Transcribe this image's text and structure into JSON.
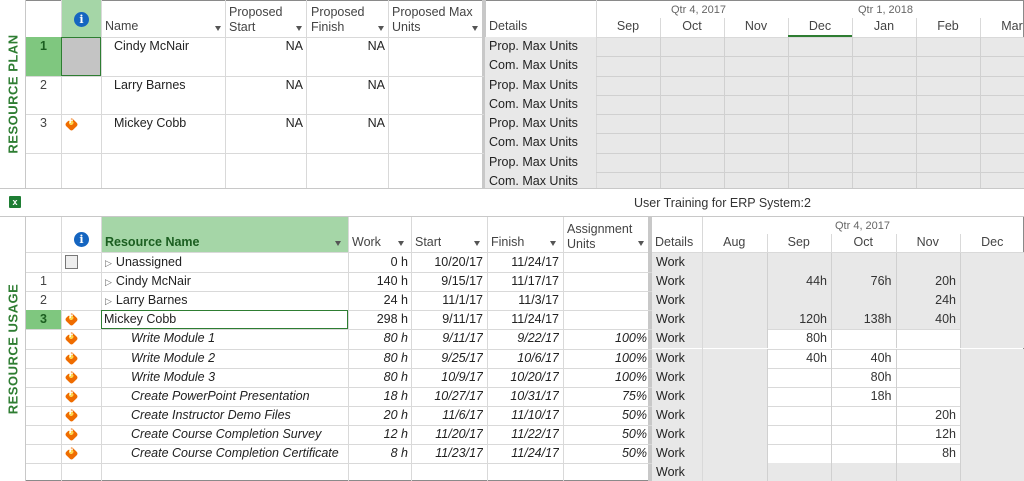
{
  "top_view": {
    "label": "RESOURCE PLAN",
    "columns": {
      "name": "Name",
      "start": "Proposed Start",
      "finish": "Proposed Finish",
      "maxunits": "Proposed Max Units",
      "details": "Details"
    },
    "timescale_top": [
      "Qtr 4, 2017",
      "Qtr 1, 2018"
    ],
    "timescale_bottom": [
      "Sep",
      "Oct",
      "Nov",
      "Dec",
      "Jan",
      "Feb",
      "Mar"
    ],
    "rows": [
      {
        "num": "1",
        "name": "Cindy McNair",
        "start": "NA",
        "finish": "NA",
        "details": [
          "Prop. Max Units",
          "Com. Max Units"
        ]
      },
      {
        "num": "2",
        "name": "Larry Barnes",
        "start": "NA",
        "finish": "NA",
        "details": [
          "Prop. Max Units",
          "Com. Max Units"
        ]
      },
      {
        "num": "3",
        "name": "Mickey Cobb",
        "start": "NA",
        "finish": "NA",
        "details": [
          "Prop. Max Units",
          "Com. Max Units"
        ]
      },
      {
        "num": "",
        "name": "",
        "start": "",
        "finish": "",
        "details": [
          "Prop. Max Units",
          "Com. Max Units"
        ]
      }
    ]
  },
  "divider": {
    "title": "User Training for ERP System:2"
  },
  "bottom_view": {
    "label": "RESOURCE USAGE",
    "columns": {
      "name": "Resource Name",
      "work": "Work",
      "start": "Start",
      "finish": "Finish",
      "units": "Assignment Units",
      "details": "Details"
    },
    "timescale_top": "Qtr 4, 2017",
    "timescale_bottom": [
      "Aug",
      "Sep",
      "Oct",
      "Nov",
      "Dec"
    ],
    "rows": [
      {
        "num": "",
        "type": "unassigned",
        "name": "Unassigned",
        "work": "0 h",
        "start": "10/20/17",
        "finish": "11/24/17",
        "units": "",
        "detail": "Work",
        "values": [
          "",
          "",
          "",
          "",
          ""
        ]
      },
      {
        "num": "1",
        "type": "summary",
        "name": "Cindy McNair",
        "work": "140 h",
        "start": "9/15/17",
        "finish": "11/17/17",
        "units": "",
        "detail": "Work",
        "values": [
          "",
          "44h",
          "76h",
          "20h",
          ""
        ]
      },
      {
        "num": "2",
        "type": "summary",
        "name": "Larry Barnes",
        "work": "24 h",
        "start": "11/1/17",
        "finish": "11/3/17",
        "units": "",
        "detail": "Work",
        "values": [
          "",
          "",
          "",
          "24h",
          ""
        ]
      },
      {
        "num": "3",
        "type": "selected",
        "name": "Mickey Cobb",
        "work": "298 h",
        "start": "9/11/17",
        "finish": "11/24/17",
        "units": "",
        "detail": "Work",
        "values": [
          "",
          "120h",
          "138h",
          "40h",
          ""
        ]
      },
      {
        "num": "",
        "type": "task",
        "name": "Write Module 1",
        "work": "80 h",
        "start": "9/11/17",
        "finish": "9/22/17",
        "units": "100%",
        "detail": "Work",
        "values": [
          "",
          "80h",
          "",
          "",
          ""
        ]
      },
      {
        "num": "",
        "type": "task",
        "name": "Write Module 2",
        "work": "80 h",
        "start": "9/25/17",
        "finish": "10/6/17",
        "units": "100%",
        "detail": "Work",
        "values": [
          "",
          "40h",
          "40h",
          "",
          ""
        ]
      },
      {
        "num": "",
        "type": "task",
        "name": "Write Module 3",
        "work": "80 h",
        "start": "10/9/17",
        "finish": "10/20/17",
        "units": "100%",
        "detail": "Work",
        "values": [
          "",
          "",
          "80h",
          "",
          ""
        ]
      },
      {
        "num": "",
        "type": "task",
        "name": "Create PowerPoint Presentation",
        "work": "18 h",
        "start": "10/27/17",
        "finish": "10/31/17",
        "units": "75%",
        "detail": "Work",
        "values": [
          "",
          "",
          "18h",
          "",
          ""
        ]
      },
      {
        "num": "",
        "type": "task",
        "name": "Create Instructor Demo Files",
        "work": "20 h",
        "start": "11/6/17",
        "finish": "11/10/17",
        "units": "50%",
        "detail": "Work",
        "values": [
          "",
          "",
          "",
          "20h",
          ""
        ]
      },
      {
        "num": "",
        "type": "task",
        "name": "Create Course Completion Survey",
        "work": "12 h",
        "start": "11/20/17",
        "finish": "11/22/17",
        "units": "50%",
        "detail": "Work",
        "values": [
          "",
          "",
          "",
          "12h",
          ""
        ]
      },
      {
        "num": "",
        "type": "task",
        "name": "Create Course Completion Certificate",
        "work": "8 h",
        "start": "11/23/17",
        "finish": "11/24/17",
        "units": "50%",
        "detail": "Work",
        "values": [
          "",
          "",
          "",
          "8h",
          ""
        ]
      },
      {
        "num": "",
        "type": "empty",
        "name": "",
        "work": "",
        "start": "",
        "finish": "",
        "units": "",
        "detail": "Work",
        "values": [
          "",
          "",
          "",
          "",
          ""
        ]
      }
    ]
  },
  "colors": {
    "accent_green": "#2e7d32",
    "header_green": "#a5d6a7",
    "selected_row_num": "#7fc77f",
    "grey_fill": "#e8e8e8"
  },
  "icons": {
    "info": "info-icon",
    "resource": "resource-icon",
    "unassigned": "unassigned-icon",
    "excel": "excel-icon"
  }
}
